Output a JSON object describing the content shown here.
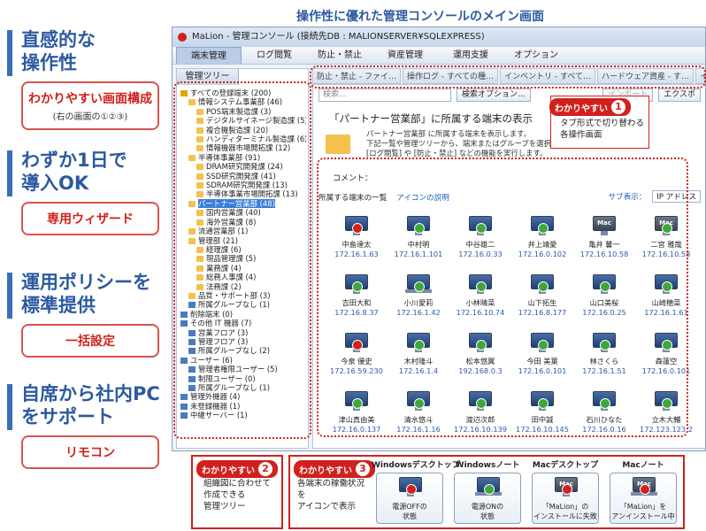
{
  "main_title": "操作性に優れた管理コンソールのメイン画面",
  "features": [
    {
      "head1": "直感的な",
      "head2": "操作性",
      "pill": "わかりやすい画面構成",
      "pill_sub": "(右の画面の①②③)"
    },
    {
      "head1": "わずか1日で",
      "head2": "導入OK",
      "pill": "専用ウィザード",
      "pill_sub": ""
    },
    {
      "head1": "運用ポリシーを",
      "head2": "標準提供",
      "pill": "一括設定",
      "pill_sub": ""
    },
    {
      "head1": "自席から社内PC",
      "head2": "をサポート",
      "pill": "リモコン",
      "pill_sub": ""
    }
  ],
  "window": {
    "title": "MaLion - 管理コンソール (接続先DB : MALIONSERVER¥SQLEXPRESS)",
    "menu": [
      "端末管理",
      "ログ閲覧",
      "防止・禁止",
      "資産管理",
      "運用支援",
      "オプション"
    ],
    "tree_tab": "管理ツリー",
    "tree": [
      {
        "label": "すべての登録端末 (200)",
        "indent": 0,
        "icon": "warn"
      },
      {
        "label": "情報システム事業部 (46)",
        "indent": 1,
        "icon": "folder"
      },
      {
        "label": "POS端末製造課 (3)",
        "indent": 2,
        "icon": "folder"
      },
      {
        "label": "デジタルサイネージ製造課 (5)",
        "indent": 2,
        "icon": "folder"
      },
      {
        "label": "複合機製造課 (20)",
        "indent": 2,
        "icon": "folder"
      },
      {
        "label": "ハンディターミナル製造課 (6)",
        "indent": 2,
        "icon": "folder"
      },
      {
        "label": "情報機器市場開拓課 (12)",
        "indent": 2,
        "icon": "folder"
      },
      {
        "label": "半導体事業部 (91)",
        "indent": 1,
        "icon": "folder"
      },
      {
        "label": "DRAM研究開発課 (24)",
        "indent": 2,
        "icon": "folder"
      },
      {
        "label": "SSD研究開発課 (41)",
        "indent": 2,
        "icon": "folder"
      },
      {
        "label": "SDRAM研究開発課 (13)",
        "indent": 2,
        "icon": "folder"
      },
      {
        "label": "半導体事業市場開拓課 (13)",
        "indent": 2,
        "icon": "folder"
      },
      {
        "label": "パートナー営業部 (48)",
        "indent": 1,
        "icon": "folder",
        "selected": true
      },
      {
        "label": "国内営業課 (40)",
        "indent": 2,
        "icon": "folder"
      },
      {
        "label": "海外営業課 (8)",
        "indent": 2,
        "icon": "folder"
      },
      {
        "label": "流通営業部 (1)",
        "indent": 1,
        "icon": "folder"
      },
      {
        "label": "管理部 (21)",
        "indent": 1,
        "icon": "folder"
      },
      {
        "label": "経理課 (6)",
        "indent": 2,
        "icon": "folder"
      },
      {
        "label": "現品管理課 (5)",
        "indent": 2,
        "icon": "folder"
      },
      {
        "label": "業務課 (4)",
        "indent": 2,
        "icon": "folder"
      },
      {
        "label": "総務人事課 (4)",
        "indent": 2,
        "icon": "folder"
      },
      {
        "label": "法務課 (2)",
        "indent": 2,
        "icon": "folder"
      },
      {
        "label": "品質・サポート部 (3)",
        "indent": 1,
        "icon": "folder"
      },
      {
        "label": "所属グループなし (1)",
        "indent": 1,
        "icon": "computer"
      },
      {
        "label": "削除端末 (0)",
        "indent": 0,
        "icon": "computer"
      },
      {
        "label": "その他 IT 機器 (7)",
        "indent": 0,
        "icon": "computer"
      },
      {
        "label": "営業フロア (3)",
        "indent": 1,
        "icon": "computer"
      },
      {
        "label": "管理フロア (3)",
        "indent": 1,
        "icon": "computer"
      },
      {
        "label": "所属グループなし (2)",
        "indent": 1,
        "icon": "computer"
      },
      {
        "label": "ユーザー (6)",
        "indent": 0,
        "icon": "computer"
      },
      {
        "label": "管理者権限ユーザー (5)",
        "indent": 1,
        "icon": "computer"
      },
      {
        "label": "制限ユーザー (0)",
        "indent": 1,
        "icon": "computer"
      },
      {
        "label": "所属グループなし (1)",
        "indent": 1,
        "icon": "computer"
      },
      {
        "label": "管理外機器 (4)",
        "indent": 0,
        "icon": "computer"
      },
      {
        "label": "未登録機器 (1)",
        "indent": 0,
        "icon": "computer"
      },
      {
        "label": "中継サーバー (1)",
        "indent": 0,
        "icon": "computer"
      }
    ],
    "tabs": [
      "防止・禁止 - ファイ…",
      "操作ログ - すべての種…",
      "インベントリ - すべて…",
      "ハードウェア資産 - す…",
      "インス"
    ],
    "search_placeholder": "検索...",
    "search_options": "検索オプション...",
    "import_label": "インポート",
    "export_label": "エクスポ",
    "content_heading": "「パートナー営業部」に所属する端末の表示",
    "description": "パートナー営業部 に所属する端末を表示します。\n下記一覧や管理ツリーから、端末またはグループを選択し、\n[ログ閲覧] や [防止・禁止] などの機能を実行します。",
    "comment_label": "コメント：",
    "list_title": "所属する端末の一覧",
    "icon_help": "アイコンの説明",
    "sub_display_label": "サブ表示：",
    "sub_display_value": "IP アドレス",
    "terminals": [
      {
        "name": "中島達太",
        "ip": "172.16.1.63",
        "type": "desktop",
        "status": "off"
      },
      {
        "name": "中村明",
        "ip": "172.16.1.101",
        "type": "desktop",
        "status": "on"
      },
      {
        "name": "中谷雄二",
        "ip": "172.16.0.33",
        "type": "desktop",
        "status": "on"
      },
      {
        "name": "井上靖愛",
        "ip": "172.16.0.102",
        "type": "desktop",
        "status": "on"
      },
      {
        "name": "亀井 馨一",
        "ip": "172.16.10.58",
        "type": "mac",
        "status": "none"
      },
      {
        "name": "二宮 雅哉",
        "ip": "172.16.10.58",
        "type": "mac",
        "status": "on"
      },
      {
        "name": "吉田大和",
        "ip": "172.16.8.37",
        "type": "desktop",
        "status": "on"
      },
      {
        "name": "小川愛莉",
        "ip": "172.16.1.42",
        "type": "laptop",
        "status": "on"
      },
      {
        "name": "小林晴菜",
        "ip": "172.16.10.74",
        "type": "desktop",
        "status": "on"
      },
      {
        "name": "山下拓生",
        "ip": "172.16.8.177",
        "type": "desktop",
        "status": "on"
      },
      {
        "name": "山口美桜",
        "ip": "172.16.0.25",
        "type": "desktop",
        "status": "on"
      },
      {
        "name": "山崎穂菜",
        "ip": "172.16.1.61",
        "type": "desktop",
        "status": "on"
      },
      {
        "name": "今泉 優史",
        "ip": "172.16.59.230",
        "type": "desktop",
        "status": "off"
      },
      {
        "name": "木村隆斗",
        "ip": "172.16.1.4",
        "type": "desktop",
        "status": "on"
      },
      {
        "name": "松本悠翼",
        "ip": "192.168.0.3",
        "type": "desktop",
        "status": "on"
      },
      {
        "name": "今田 美葉",
        "ip": "172.16.0.101",
        "type": "desktop",
        "status": "on"
      },
      {
        "name": "林さくら",
        "ip": "172.16.1.51",
        "type": "desktop",
        "status": "on"
      },
      {
        "name": "森蓮空",
        "ip": "172.16.0.101",
        "type": "desktop",
        "status": "on"
      },
      {
        "name": "津山真由美",
        "ip": "172.16.0.137",
        "type": "desktop",
        "status": "on"
      },
      {
        "name": "清水悠斗",
        "ip": "172.16.1.16",
        "type": "desktop",
        "status": "on"
      },
      {
        "name": "渡辺次郎",
        "ip": "172.16.10.139",
        "type": "desktop",
        "status": "on"
      },
      {
        "name": "田中誠",
        "ip": "172.16.10.145",
        "type": "desktop",
        "status": "on"
      },
      {
        "name": "石川ひなた",
        "ip": "172.16.0.16",
        "type": "desktop",
        "status": "on"
      },
      {
        "name": "立木大輔",
        "ip": "172.123.123.2",
        "type": "desktop",
        "status": "on"
      }
    ]
  },
  "callouts": {
    "easy_label": "わかりやすい",
    "c1_num": "1",
    "c1_text": "タブ形式で切り替わる\n各操作画面",
    "c2_num": "2",
    "c2_text": "組織図に合わせて\n作成できる\n管理ツリー",
    "c3_num": "3",
    "c3_text": "各端末の稼働状況を\nアイコンで表示",
    "legend": [
      {
        "title": "Windowsデスクトップ",
        "caption": "電源OFFの\n状態",
        "type": "desktop",
        "status": "off"
      },
      {
        "title": "Windowsノート",
        "caption": "電源ONの\n状態",
        "type": "laptop",
        "status": "on"
      },
      {
        "title": "Macデスクトップ",
        "caption": "「MaLion」の\nインストールに失敗",
        "type": "mac",
        "status": "off"
      },
      {
        "title": "Macノート",
        "caption": "「MaLion」を\nアンインストール中",
        "type": "mac-laptop",
        "status": "off"
      }
    ]
  },
  "colors": {
    "accent_blue": "#2c5aa0",
    "accent_red": "#d0211c",
    "status_on": "#3fa73a",
    "status_off": "#d0211c"
  }
}
